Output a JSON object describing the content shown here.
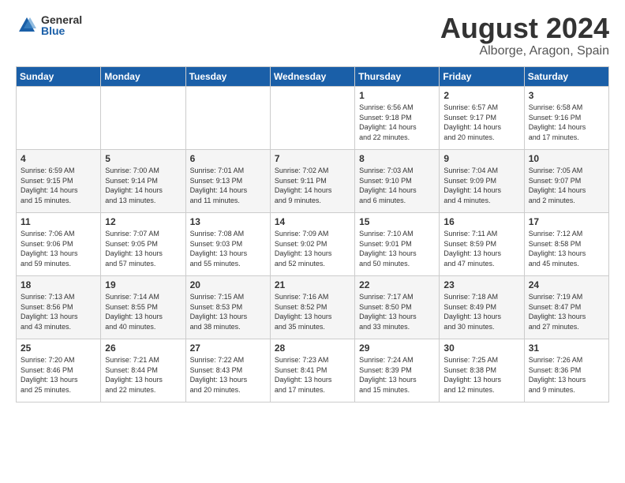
{
  "header": {
    "logo_general": "General",
    "logo_blue": "Blue",
    "title": "August 2024",
    "location": "Alborge, Aragon, Spain"
  },
  "weekdays": [
    "Sunday",
    "Monday",
    "Tuesday",
    "Wednesday",
    "Thursday",
    "Friday",
    "Saturday"
  ],
  "weeks": [
    [
      {
        "day": "",
        "info": ""
      },
      {
        "day": "",
        "info": ""
      },
      {
        "day": "",
        "info": ""
      },
      {
        "day": "",
        "info": ""
      },
      {
        "day": "1",
        "info": "Sunrise: 6:56 AM\nSunset: 9:18 PM\nDaylight: 14 hours\nand 22 minutes."
      },
      {
        "day": "2",
        "info": "Sunrise: 6:57 AM\nSunset: 9:17 PM\nDaylight: 14 hours\nand 20 minutes."
      },
      {
        "day": "3",
        "info": "Sunrise: 6:58 AM\nSunset: 9:16 PM\nDaylight: 14 hours\nand 17 minutes."
      }
    ],
    [
      {
        "day": "4",
        "info": "Sunrise: 6:59 AM\nSunset: 9:15 PM\nDaylight: 14 hours\nand 15 minutes."
      },
      {
        "day": "5",
        "info": "Sunrise: 7:00 AM\nSunset: 9:14 PM\nDaylight: 14 hours\nand 13 minutes."
      },
      {
        "day": "6",
        "info": "Sunrise: 7:01 AM\nSunset: 9:13 PM\nDaylight: 14 hours\nand 11 minutes."
      },
      {
        "day": "7",
        "info": "Sunrise: 7:02 AM\nSunset: 9:11 PM\nDaylight: 14 hours\nand 9 minutes."
      },
      {
        "day": "8",
        "info": "Sunrise: 7:03 AM\nSunset: 9:10 PM\nDaylight: 14 hours\nand 6 minutes."
      },
      {
        "day": "9",
        "info": "Sunrise: 7:04 AM\nSunset: 9:09 PM\nDaylight: 14 hours\nand 4 minutes."
      },
      {
        "day": "10",
        "info": "Sunrise: 7:05 AM\nSunset: 9:07 PM\nDaylight: 14 hours\nand 2 minutes."
      }
    ],
    [
      {
        "day": "11",
        "info": "Sunrise: 7:06 AM\nSunset: 9:06 PM\nDaylight: 13 hours\nand 59 minutes."
      },
      {
        "day": "12",
        "info": "Sunrise: 7:07 AM\nSunset: 9:05 PM\nDaylight: 13 hours\nand 57 minutes."
      },
      {
        "day": "13",
        "info": "Sunrise: 7:08 AM\nSunset: 9:03 PM\nDaylight: 13 hours\nand 55 minutes."
      },
      {
        "day": "14",
        "info": "Sunrise: 7:09 AM\nSunset: 9:02 PM\nDaylight: 13 hours\nand 52 minutes."
      },
      {
        "day": "15",
        "info": "Sunrise: 7:10 AM\nSunset: 9:01 PM\nDaylight: 13 hours\nand 50 minutes."
      },
      {
        "day": "16",
        "info": "Sunrise: 7:11 AM\nSunset: 8:59 PM\nDaylight: 13 hours\nand 47 minutes."
      },
      {
        "day": "17",
        "info": "Sunrise: 7:12 AM\nSunset: 8:58 PM\nDaylight: 13 hours\nand 45 minutes."
      }
    ],
    [
      {
        "day": "18",
        "info": "Sunrise: 7:13 AM\nSunset: 8:56 PM\nDaylight: 13 hours\nand 43 minutes."
      },
      {
        "day": "19",
        "info": "Sunrise: 7:14 AM\nSunset: 8:55 PM\nDaylight: 13 hours\nand 40 minutes."
      },
      {
        "day": "20",
        "info": "Sunrise: 7:15 AM\nSunset: 8:53 PM\nDaylight: 13 hours\nand 38 minutes."
      },
      {
        "day": "21",
        "info": "Sunrise: 7:16 AM\nSunset: 8:52 PM\nDaylight: 13 hours\nand 35 minutes."
      },
      {
        "day": "22",
        "info": "Sunrise: 7:17 AM\nSunset: 8:50 PM\nDaylight: 13 hours\nand 33 minutes."
      },
      {
        "day": "23",
        "info": "Sunrise: 7:18 AM\nSunset: 8:49 PM\nDaylight: 13 hours\nand 30 minutes."
      },
      {
        "day": "24",
        "info": "Sunrise: 7:19 AM\nSunset: 8:47 PM\nDaylight: 13 hours\nand 27 minutes."
      }
    ],
    [
      {
        "day": "25",
        "info": "Sunrise: 7:20 AM\nSunset: 8:46 PM\nDaylight: 13 hours\nand 25 minutes."
      },
      {
        "day": "26",
        "info": "Sunrise: 7:21 AM\nSunset: 8:44 PM\nDaylight: 13 hours\nand 22 minutes."
      },
      {
        "day": "27",
        "info": "Sunrise: 7:22 AM\nSunset: 8:43 PM\nDaylight: 13 hours\nand 20 minutes."
      },
      {
        "day": "28",
        "info": "Sunrise: 7:23 AM\nSunset: 8:41 PM\nDaylight: 13 hours\nand 17 minutes."
      },
      {
        "day": "29",
        "info": "Sunrise: 7:24 AM\nSunset: 8:39 PM\nDaylight: 13 hours\nand 15 minutes."
      },
      {
        "day": "30",
        "info": "Sunrise: 7:25 AM\nSunset: 8:38 PM\nDaylight: 13 hours\nand 12 minutes."
      },
      {
        "day": "31",
        "info": "Sunrise: 7:26 AM\nSunset: 8:36 PM\nDaylight: 13 hours\nand 9 minutes."
      }
    ]
  ]
}
